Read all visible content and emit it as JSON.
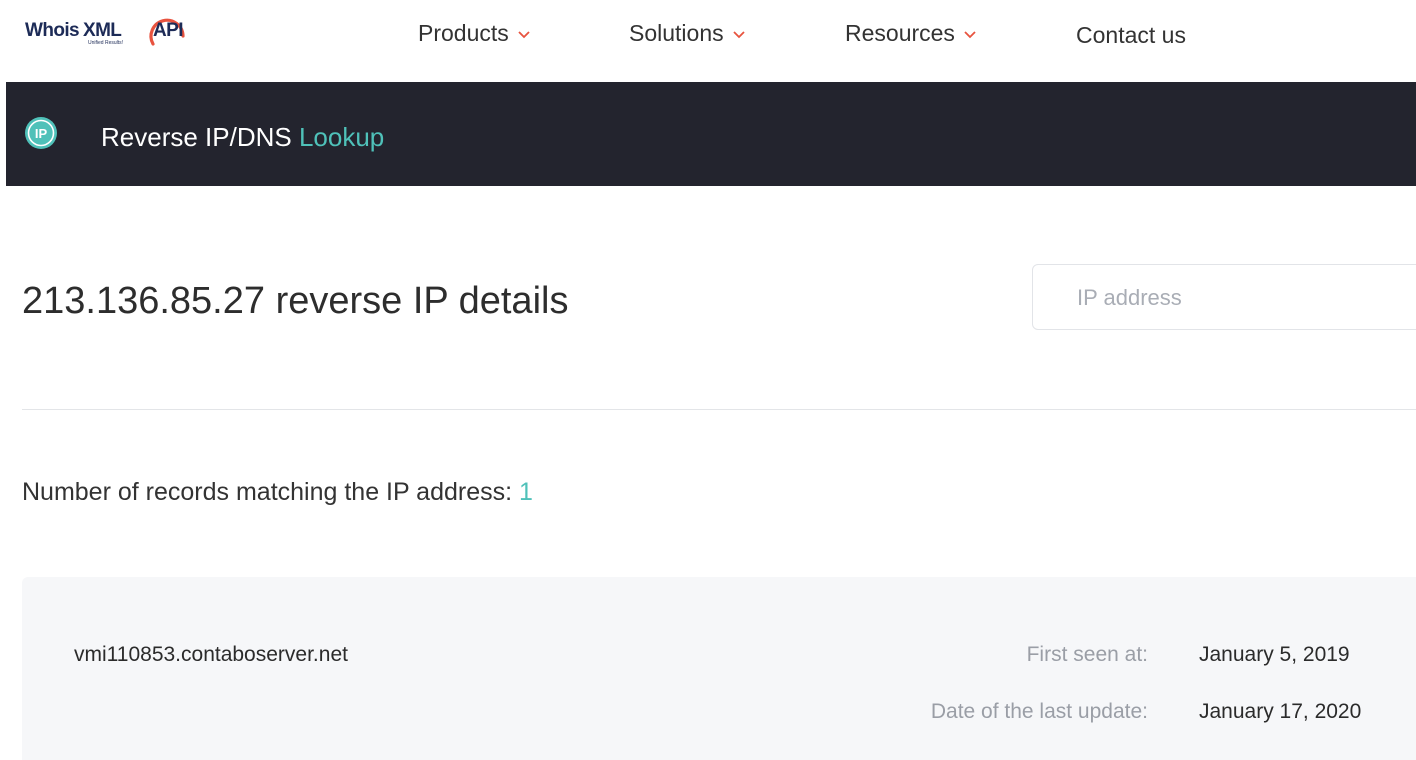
{
  "logo": {
    "whois": "Whois",
    "xml": "XML",
    "api": "API",
    "tagline": "Unified Results!"
  },
  "nav": {
    "items": [
      {
        "label": "Products",
        "has_dropdown": true
      },
      {
        "label": "Solutions",
        "has_dropdown": true
      },
      {
        "label": "Resources",
        "has_dropdown": true
      },
      {
        "label": "Contact us",
        "has_dropdown": false
      }
    ]
  },
  "tool": {
    "icon_text": "IP",
    "title_main": "Reverse IP/DNS ",
    "title_accent": "Lookup"
  },
  "main": {
    "heading": "213.136.85.27 reverse IP details",
    "search_placeholder": "IP address",
    "records_label": "Number of records matching the IP address: ",
    "records_count": "1"
  },
  "result": {
    "hostname": "vmi110853.contaboserver.net",
    "first_seen_label": "First seen at:",
    "first_seen_value": "January 5, 2019",
    "last_update_label": "Date of the last update:",
    "last_update_value": "January 17, 2020"
  },
  "colors": {
    "accent": "#4fc1b9",
    "dark_bar": "#23242e",
    "brand_navy": "#1d2b57",
    "brand_red": "#e8533f"
  }
}
